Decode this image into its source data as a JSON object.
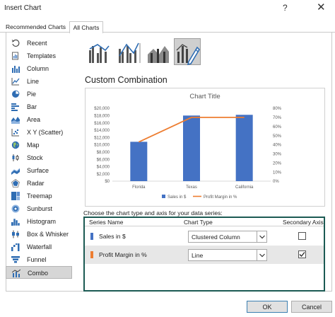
{
  "window": {
    "title": "Insert Chart",
    "help": "?",
    "close": "✕"
  },
  "tabs": [
    {
      "label": "Recommended Charts",
      "active": false
    },
    {
      "label": "All Charts",
      "active": true
    }
  ],
  "sidebar": {
    "items": [
      {
        "label": "Recent",
        "icon": "recent-icon"
      },
      {
        "label": "Templates",
        "icon": "templates-icon"
      },
      {
        "label": "Column",
        "icon": "column-chart-icon"
      },
      {
        "label": "Line",
        "icon": "line-chart-icon"
      },
      {
        "label": "Pie",
        "icon": "pie-chart-icon"
      },
      {
        "label": "Bar",
        "icon": "bar-chart-icon"
      },
      {
        "label": "Area",
        "icon": "area-chart-icon"
      },
      {
        "label": "X Y (Scatter)",
        "icon": "scatter-chart-icon"
      },
      {
        "label": "Map",
        "icon": "map-chart-icon"
      },
      {
        "label": "Stock",
        "icon": "stock-chart-icon"
      },
      {
        "label": "Surface",
        "icon": "surface-chart-icon"
      },
      {
        "label": "Radar",
        "icon": "radar-chart-icon"
      },
      {
        "label": "Treemap",
        "icon": "treemap-chart-icon"
      },
      {
        "label": "Sunburst",
        "icon": "sunburst-chart-icon"
      },
      {
        "label": "Histogram",
        "icon": "histogram-chart-icon"
      },
      {
        "label": "Box & Whisker",
        "icon": "box-whisker-chart-icon"
      },
      {
        "label": "Waterfall",
        "icon": "waterfall-chart-icon"
      },
      {
        "label": "Funnel",
        "icon": "funnel-chart-icon"
      },
      {
        "label": "Combo",
        "icon": "combo-chart-icon"
      }
    ],
    "selected": "Combo"
  },
  "combo": {
    "heading": "Custom Combination",
    "choose_text": "Choose the chart type and axis for your data series:",
    "columns": {
      "series_name": "Series Name",
      "chart_type": "Chart Type",
      "secondary_axis": "Secondary Axis"
    },
    "series": [
      {
        "name": "Sales in $",
        "chart_type": "Clustered Column",
        "secondary_axis": false,
        "color": "#4472c4"
      },
      {
        "name": "Profit Margin in %",
        "chart_type": "Line",
        "secondary_axis": true,
        "color": "#ed7d31"
      }
    ]
  },
  "chart_data": {
    "type": "bar",
    "title": "Chart Title",
    "categories": [
      "Florida",
      "Texas",
      "California"
    ],
    "series": [
      {
        "name": "Sales in $",
        "type": "bar",
        "axis": "primary",
        "color": "#4472c4",
        "values": [
          10800,
          18000,
          18200
        ]
      },
      {
        "name": "Profit Margin in %",
        "type": "line",
        "axis": "secondary",
        "color": "#ed7d31",
        "values": [
          43,
          70,
          70
        ]
      }
    ],
    "y_left": {
      "ylim": [
        0,
        20000
      ],
      "ticks": [
        "$0",
        "$2,000",
        "$4,000",
        "$6,000",
        "$8,000",
        "$10,000",
        "$12,000",
        "$14,000",
        "$16,000",
        "$18,000",
        "$20,000"
      ]
    },
    "y_right": {
      "ylim": [
        0,
        80
      ],
      "ticks": [
        "0%",
        "10%",
        "20%",
        "30%",
        "40%",
        "50%",
        "60%",
        "70%",
        "80%"
      ]
    },
    "legend": "bottom",
    "grid": false
  },
  "buttons": {
    "ok": "OK",
    "cancel": "Cancel"
  }
}
